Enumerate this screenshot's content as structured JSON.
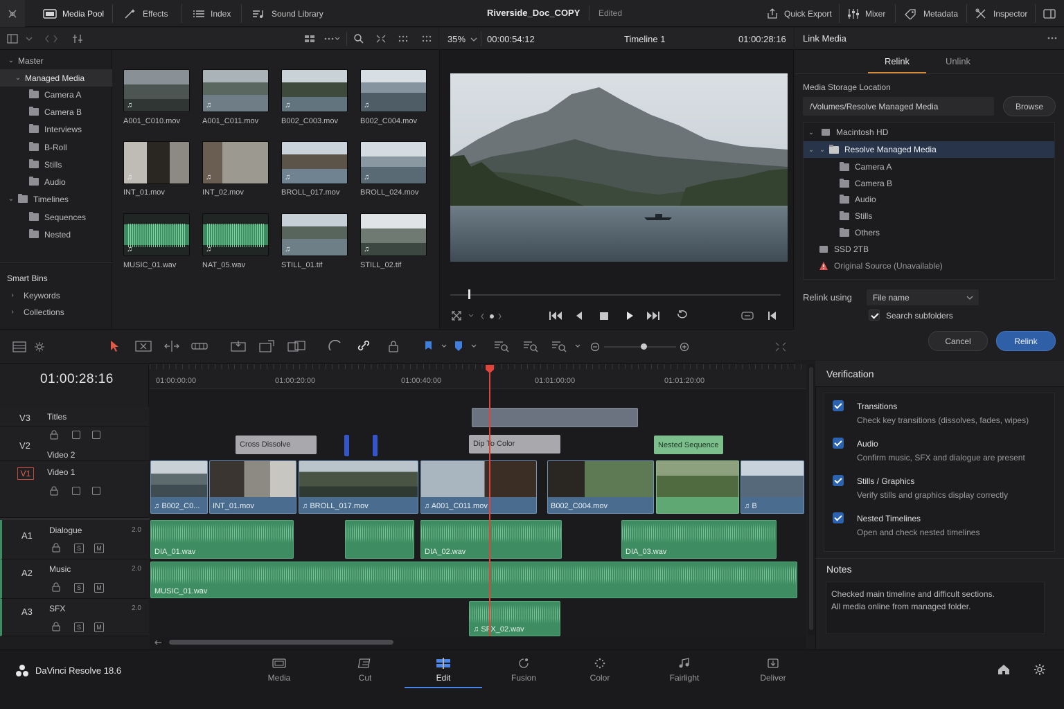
{
  "topbar": {
    "media_pool": "Media Pool",
    "effects": "Effects",
    "index": "Index",
    "sound_library": "Sound Library",
    "project_title": "Riverside_Doc_COPY",
    "edited": "Edited",
    "quick_export": "Quick Export",
    "mixer": "Mixer",
    "metadata": "Metadata",
    "inspector": "Inspector"
  },
  "bins": {
    "master": "Master",
    "managed_media": "Managed Media",
    "items": [
      "Camera A",
      "Camera B",
      "Interviews",
      "B-Roll",
      "Stills",
      "Audio"
    ],
    "timelines": "Timelines",
    "timeline_items": [
      "Sequences",
      "Nested"
    ],
    "smart_bins": "Smart Bins",
    "smart_items": [
      "Keywords",
      "Collections"
    ]
  },
  "clips": [
    {
      "name": "A001_C010.mov",
      "kind": "video"
    },
    {
      "name": "A001_C011.mov",
      "kind": "video"
    },
    {
      "name": "B002_C003.mov",
      "kind": "video"
    },
    {
      "name": "B002_C004.mov",
      "kind": "video"
    },
    {
      "name": "INT_01.mov",
      "kind": "video"
    },
    {
      "name": "INT_02.mov",
      "kind": "video"
    },
    {
      "name": "BROLL_017.mov",
      "kind": "video"
    },
    {
      "name": "BROLL_024.mov",
      "kind": "video"
    },
    {
      "name": "MUSIC_01.wav",
      "kind": "audio"
    },
    {
      "name": "NAT_05.wav",
      "kind": "audio"
    },
    {
      "name": "STILL_01.tif",
      "kind": "still"
    },
    {
      "name": "STILL_02.tif",
      "kind": "still"
    }
  ],
  "viewer": {
    "zoom": "35%",
    "source_tc": "00:00:54:12",
    "timeline_name": "Timeline 1",
    "record_tc": "01:00:28:16",
    "scrub_position": 0.055
  },
  "link_media": {
    "title": "Link Media",
    "tab_relink": "Relink",
    "tab_unlink": "Unlink",
    "storage_label": "Media Storage Location",
    "storage_path": "/Volumes/Resolve Managed Media",
    "browse": "Browse",
    "tree": {
      "macintosh": "Macintosh HD",
      "resolve_managed": "Resolve Managed Media",
      "children": [
        "Camera A",
        "Camera B",
        "Audio",
        "Stills",
        "Others"
      ],
      "ssd": "SSD 2TB",
      "original": "Original Source (Unavailable)"
    },
    "relink_using_label": "Relink using",
    "relink_using_value": "File name",
    "search_subfolders": "Search subfolders",
    "cancel": "Cancel",
    "relink": "Relink"
  },
  "verification": {
    "title": "Verification",
    "items": [
      {
        "title": "Transitions",
        "desc": "Check key transitions (dissolves, fades, wipes)"
      },
      {
        "title": "Audio",
        "desc": "Confirm music, SFX and dialogue are present"
      },
      {
        "title": "Stills / Graphics",
        "desc": "Verify stills and graphics display correctly"
      },
      {
        "title": "Nested Timelines",
        "desc": "Open and check nested timelines"
      }
    ]
  },
  "notes": {
    "title": "Notes",
    "line1": "Checked main timeline and difficult sections.",
    "line2": "All media online from managed folder."
  },
  "timeline": {
    "timecode": "01:00:28:16",
    "ruler": [
      "01:00:00:00",
      "01:00:20:00",
      "01:00:40:00",
      "01:01:00:00",
      "01:01:20:00"
    ],
    "tracks": {
      "v3": {
        "num": "V3",
        "name": "Titles"
      },
      "v2": {
        "num": "V2",
        "name": "Video 2"
      },
      "v1": {
        "num": "V1",
        "name": "Video 1"
      },
      "a1": {
        "num": "A1",
        "name": "Dialogue",
        "level": "2.0"
      },
      "a2": {
        "num": "A2",
        "name": "Music",
        "level": "2.0"
      },
      "a3": {
        "num": "A3",
        "name": "SFX",
        "level": "2.0"
      }
    },
    "transitions": {
      "cross": "Cross Dissolve",
      "dip": "Dip To Color",
      "nested": "Nested Sequence"
    },
    "v1_clips": [
      "B002_C0...",
      "INT_01.mov",
      "BROLL_017.mov",
      "A001_C011.mov",
      "B002_C004.mov",
      "B"
    ],
    "a1_clips": [
      "DIA_01.wav",
      "DIA_02.wav",
      "DIA_03.wav"
    ],
    "a2_clip": "MUSIC_01.wav",
    "a3_clip": "SFX_02.wav",
    "solo": "S",
    "mute": "M"
  },
  "pages": {
    "app_name": "DaVinci Resolve 18.6",
    "items": [
      "Media",
      "Cut",
      "Edit",
      "Fusion",
      "Color",
      "Fairlight",
      "Deliver"
    ]
  }
}
